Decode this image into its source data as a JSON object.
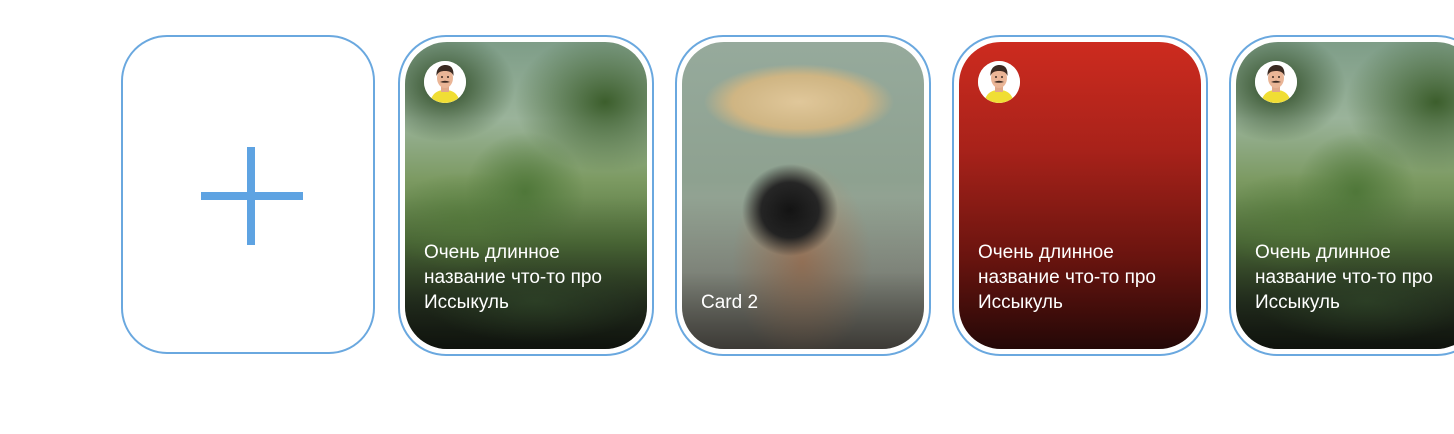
{
  "add_card": {
    "icon": "plus-icon"
  },
  "cards": [
    {
      "title": "Очень длинное название что-то про Иссыкуль",
      "has_avatar": true,
      "background": "park-photo"
    },
    {
      "title": "Card 2",
      "has_avatar": false,
      "background": "photographer-photo"
    },
    {
      "title": "Очень длинное название что-то про Иссыкуль",
      "has_avatar": true,
      "background": "red-gradient"
    },
    {
      "title": "Очень длинное название что-то про Иссыкуль",
      "has_avatar": true,
      "background": "park-photo"
    }
  ],
  "colors": {
    "border": "#6aa8df",
    "plus": "#5ea3e2",
    "caption_text": "#ffffff",
    "red_top": "#cd2b1f",
    "red_bottom": "#240807",
    "avatar_shirt": "#f0de34"
  }
}
